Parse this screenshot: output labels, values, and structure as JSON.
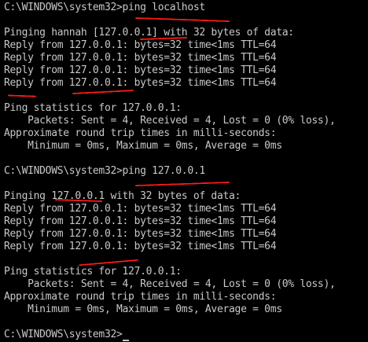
{
  "accent": {
    "annotation_red": "#ff1a1a",
    "text": "#c8c8c8",
    "background": "#000000"
  },
  "lines": [
    "C:\\WINDOWS\\system32>ping localhost",
    "",
    "Pinging hannah [127.0.0.1] with 32 bytes of data:",
    "Reply from 127.0.0.1: bytes=32 time<1ms TTL=64",
    "Reply from 127.0.0.1: bytes=32 time<1ms TTL=64",
    "Reply from 127.0.0.1: bytes=32 time<1ms TTL=64",
    "Reply from 127.0.0.1: bytes=32 time<1ms TTL=64",
    "",
    "Ping statistics for 127.0.0.1:",
    "    Packets: Sent = 4, Received = 4, Lost = 0 (0% loss),",
    "Approximate round trip times in milli-seconds:",
    "    Minimum = 0ms, Maximum = 0ms, Average = 0ms",
    "",
    "C:\\WINDOWS\\system32>ping 127.0.0.1",
    "",
    "Pinging 127.0.0.1 with 32 bytes of data:",
    "Reply from 127.0.0.1: bytes=32 time<1ms TTL=64",
    "Reply from 127.0.0.1: bytes=32 time<1ms TTL=64",
    "Reply from 127.0.0.1: bytes=32 time<1ms TTL=64",
    "Reply from 127.0.0.1: bytes=32 time<1ms TTL=64",
    "",
    "Ping statistics for 127.0.0.1:",
    "    Packets: Sent = 4, Received = 4, Lost = 0 (0% loss),",
    "Approximate round trip times in milli-seconds:",
    "    Minimum = 0ms, Maximum = 0ms, Average = 0ms",
    "",
    "C:\\WINDOWS\\system32>"
  ]
}
